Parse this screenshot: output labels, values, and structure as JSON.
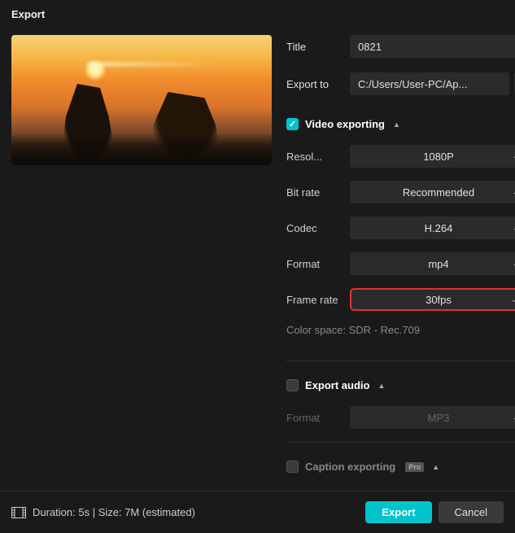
{
  "header": {
    "title": "Export"
  },
  "fields": {
    "title_label": "Title",
    "title_value": "0821",
    "export_to_label": "Export to",
    "export_to_value": "C:/Users/User-PC/Ap..."
  },
  "video": {
    "section": "Video exporting",
    "resolution_label": "Resol...",
    "resolution_value": "1080P",
    "bitrate_label": "Bit rate",
    "bitrate_value": "Recommended",
    "codec_label": "Codec",
    "codec_value": "H.264",
    "format_label": "Format",
    "format_value": "mp4",
    "framerate_label": "Frame rate",
    "framerate_value": "30fps",
    "colorspace": "Color space: SDR - Rec.709"
  },
  "audio": {
    "section": "Export audio",
    "format_label": "Format",
    "format_value": "MP3"
  },
  "caption": {
    "section": "Caption exporting",
    "badge": "Pro"
  },
  "footer": {
    "info": "Duration: 5s | Size: 7M (estimated)",
    "export": "Export",
    "cancel": "Cancel"
  }
}
